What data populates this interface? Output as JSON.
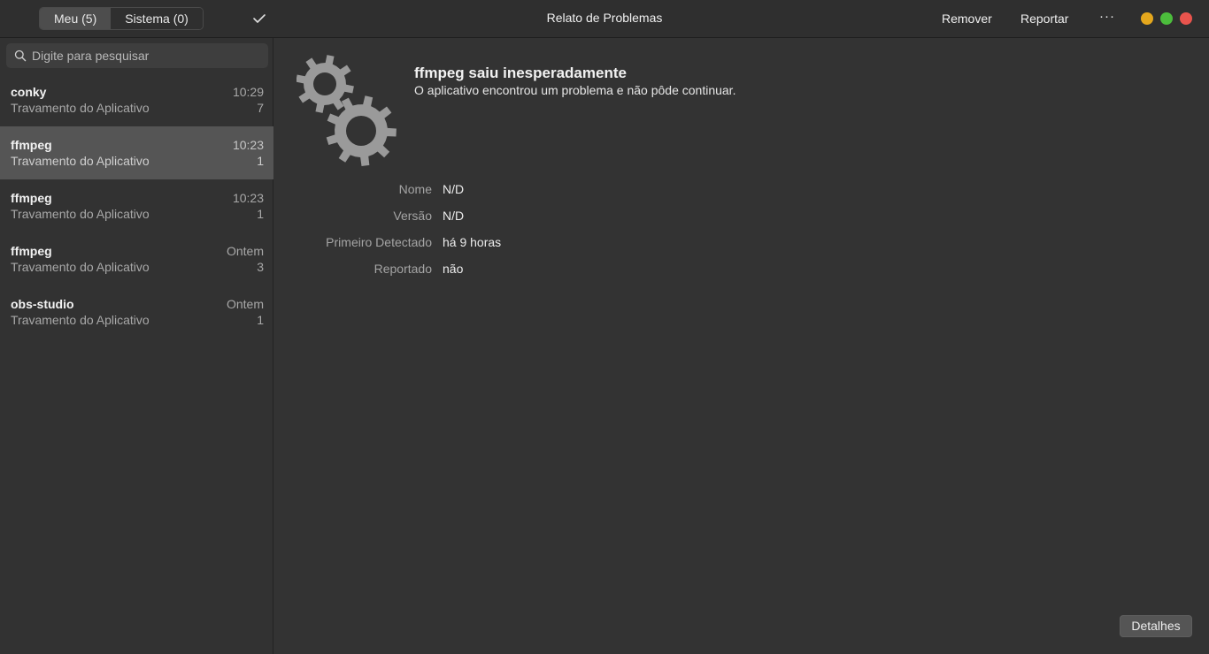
{
  "header": {
    "tabs": [
      {
        "label": "Meu (5)",
        "active": true
      },
      {
        "label": "Sistema (0)",
        "active": false
      }
    ],
    "title": "Relato de Problemas",
    "remove_label": "Remover",
    "report_label": "Reportar",
    "more_label": "···",
    "window_controls": {
      "minimize_color": "#e4a71d",
      "maximize_color": "#4cbd3c",
      "close_color": "#e9544d"
    }
  },
  "sidebar": {
    "search_placeholder": "Digite para pesquisar",
    "items": [
      {
        "name": "conky",
        "time": "10:29",
        "type": "Travamento do Aplicativo",
        "count": "7",
        "selected": false
      },
      {
        "name": "ffmpeg",
        "time": "10:23",
        "type": "Travamento do Aplicativo",
        "count": "1",
        "selected": true
      },
      {
        "name": "ffmpeg",
        "time": "10:23",
        "type": "Travamento do Aplicativo",
        "count": "1",
        "selected": false
      },
      {
        "name": "ffmpeg",
        "time": "Ontem",
        "type": "Travamento do Aplicativo",
        "count": "3",
        "selected": false
      },
      {
        "name": "obs-studio",
        "time": "Ontem",
        "type": "Travamento do Aplicativo",
        "count": "1",
        "selected": false
      }
    ]
  },
  "main": {
    "icon": "gears-icon",
    "problem_title": "ffmpeg saiu inesperadamente",
    "problem_desc": "O aplicativo encontrou um problema e não pôde continuar.",
    "details": [
      {
        "label": "Nome",
        "value": "N/D"
      },
      {
        "label": "Versão",
        "value": "N/D"
      },
      {
        "label": "Primeiro Detectado",
        "value": "há 9 horas"
      },
      {
        "label": "Reportado",
        "value": "não"
      }
    ],
    "details_button": "Detalhes"
  }
}
